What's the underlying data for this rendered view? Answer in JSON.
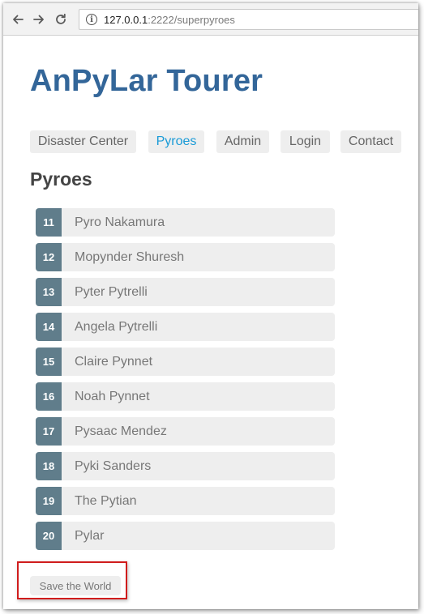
{
  "browser": {
    "url_host": "127.0.0.1",
    "url_rest": ":2222/superpyroes"
  },
  "app": {
    "title": "AnPyLar Tourer"
  },
  "menu": {
    "items": [
      {
        "label": "Disaster Center"
      },
      {
        "label": "Pyroes"
      },
      {
        "label": "Admin"
      },
      {
        "label": "Login"
      },
      {
        "label": "Contact"
      }
    ],
    "active_index": 1
  },
  "section": {
    "title": "Pyroes"
  },
  "heroes": [
    {
      "id": "11",
      "name": "Pyro Nakamura"
    },
    {
      "id": "12",
      "name": "Mopynder Shuresh"
    },
    {
      "id": "13",
      "name": "Pyter Pytrelli"
    },
    {
      "id": "14",
      "name": "Angela Pytrelli"
    },
    {
      "id": "15",
      "name": "Claire Pynnet"
    },
    {
      "id": "16",
      "name": "Noah Pynnet"
    },
    {
      "id": "17",
      "name": "Pysaac Mendez"
    },
    {
      "id": "18",
      "name": "Pyki Sanders"
    },
    {
      "id": "19",
      "name": "The Pytian"
    },
    {
      "id": "20",
      "name": "Pylar"
    }
  ],
  "actions": {
    "save_label": "Save the World"
  },
  "colors": {
    "title": "#336699",
    "active_link": "#1a9bd7",
    "badge": "#607d8b",
    "highlight": "#d01c1c"
  }
}
